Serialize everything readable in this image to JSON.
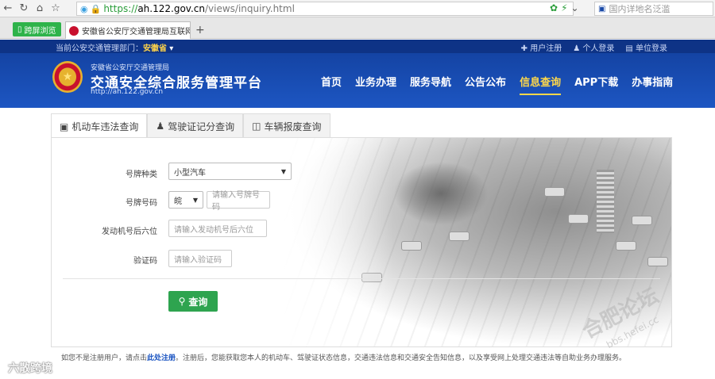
{
  "browser": {
    "url_scheme": "https://",
    "url_host": "ah.122.gov.cn",
    "url_path": "/views/inquiry.html",
    "search_placeholder": "国内详地名泛滥",
    "tab_green_label": "跨屏浏览",
    "tab_title": "安徽省公安厅交通管理局互联网",
    "tab_close": "×",
    "new_tab": "+"
  },
  "header": {
    "dept_label": "当前公安交通管理部门：",
    "dept_value": "安徽省",
    "top_links": [
      "用户注册",
      "个人登录",
      "单位登录"
    ],
    "brand_small": "安徽省公安厅交通管理局",
    "brand_main": "交通安全综合服务管理平台",
    "brand_url": "http://ah.122.gov.cn",
    "nav": [
      {
        "label": "首页"
      },
      {
        "label": "业务办理"
      },
      {
        "label": "服务导航"
      },
      {
        "label": "公告公布"
      },
      {
        "label": "信息查询",
        "active": true
      },
      {
        "label": "APP下载"
      },
      {
        "label": "办事指南"
      }
    ]
  },
  "tabs": [
    {
      "label": "机动车违法查询",
      "icon": "car-icon",
      "active": true
    },
    {
      "label": "驾驶证记分查询",
      "icon": "person-icon"
    },
    {
      "label": "车辆报废查询",
      "icon": "trash-icon"
    }
  ],
  "form": {
    "plate_type_label": "号牌种类",
    "plate_type_value": "小型汽车",
    "plate_number_label": "号牌号码",
    "plate_prefix": "皖",
    "plate_number_placeholder": "请输入号牌号码",
    "engine_label": "发动机号后六位",
    "engine_placeholder": "请输入发动机号后六位",
    "captcha_label": "验证码",
    "captcha_placeholder": "请输入验证码",
    "submit_label": "查询"
  },
  "footer": {
    "note_pre": "如您不是注册用户，请点击",
    "note_link": "此处注册",
    "note_post": "。注册后，您能获取您本人的机动车、驾驶证状态信息，交通违法信息和交通安全告知信息，以及享受网上处理交通违法等自助业务办理服务。"
  },
  "watermarks": {
    "left": "六散跨境",
    "right": "合肥论坛",
    "right_sub": "bbs.hefei.cc"
  }
}
